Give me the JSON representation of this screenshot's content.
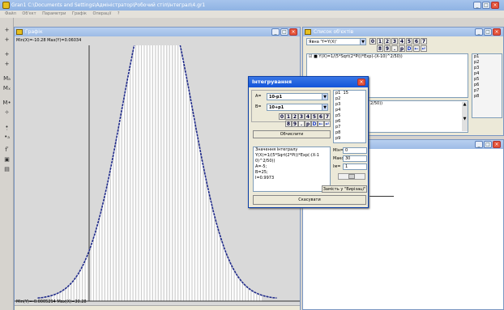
{
  "app": {
    "title": "Gran1 C:\\Documents and Settings\\Адміністратор\\Робочий стіл\\Інтеграл\\4.gr1",
    "menu": [
      "Файл",
      "Об'єкт",
      "Параметри",
      "Графік",
      "Операції",
      "?"
    ]
  },
  "left_toolbar": {
    "tools": [
      "+",
      "+",
      "+",
      "+",
      "Mₐ",
      "Mₓ",
      "M•",
      "✧",
      "•̣",
      "•ₐ",
      "fʹ",
      "▣",
      "▤"
    ]
  },
  "graph_window": {
    "title": "Графік",
    "top_info": "Min(X)=-10.28  Max(Y)=0.06034",
    "bottom_info": "Min(Y)=-0.0005294  Max(X)=30.28",
    "colors": {
      "curve": "#1f2a8a",
      "bars": "#ffffff",
      "background": "#d9d9d9"
    }
  },
  "object_list_window": {
    "title": "Список об'єктів",
    "type_label": "Явна 'Y=Y(X)'",
    "keys_row1": [
      "0",
      "1",
      "2",
      "3",
      "4",
      "5",
      "6",
      "7"
    ],
    "keys_row2": [
      "8",
      "9",
      ".",
      "p",
      "D",
      "←",
      "↵"
    ],
    "item": "Y(X)=1/(5*Sqrt(2*Pi))*Exp(-(X-10)^2/50))",
    "params": [
      "p1",
      "p2",
      "p3",
      "p4",
      "p5",
      "p6",
      "p7",
      "p8"
    ],
    "partial_text": "2/50))"
  },
  "integration_dialog": {
    "title": "Інтегрування",
    "a_label": "A=",
    "a_value": "10-p1",
    "b_label": "B=",
    "b_value": "10+p1",
    "keys_row1": [
      "0",
      "1",
      "2",
      "3",
      "4",
      "5",
      "6",
      "7"
    ],
    "keys_row2": [
      "8",
      "9",
      ".",
      "p",
      "D",
      "←",
      "↵"
    ],
    "compute_button": "Обчислити",
    "params": [
      {
        "name": "p1",
        "value": "15"
      },
      {
        "name": "p2",
        "value": ""
      },
      {
        "name": "p3",
        "value": ""
      },
      {
        "name": "p4",
        "value": ""
      },
      {
        "name": "p5",
        "value": ""
      },
      {
        "name": "p6",
        "value": ""
      },
      {
        "name": "p7",
        "value": ""
      },
      {
        "name": "p8",
        "value": ""
      },
      {
        "name": "p9",
        "value": ""
      }
    ],
    "result_lines": [
      "Значення інтегралу",
      "Y(X)=1/(5*Sqrt(2*Pi))*Exp(-(X-1",
      "0)^2/50))",
      "A=-5;",
      "B=25;",
      "I=0.9973"
    ],
    "min_label": "Мін=",
    "min_value": "0",
    "max_label": "Макс=",
    "max_value": "30",
    "step_label": "Ім=",
    "step_value": "1",
    "replace_button": "Замість у \"Вирізаці\"",
    "cancel_button": "Скасувати"
  }
}
